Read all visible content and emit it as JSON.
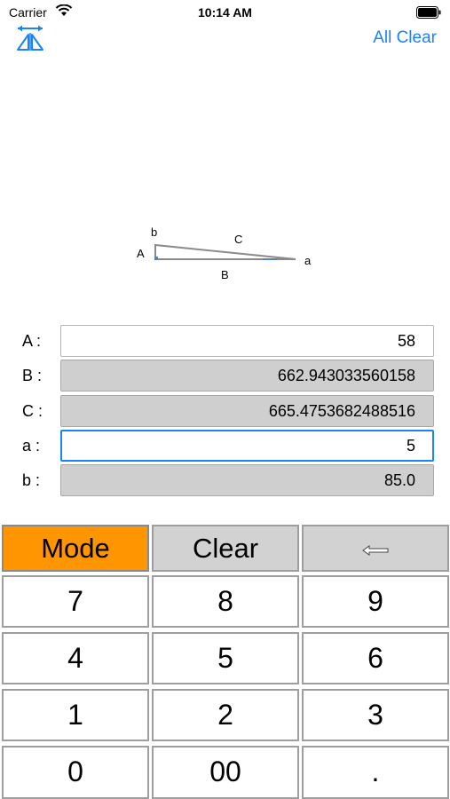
{
  "status_bar": {
    "carrier": "Carrier",
    "time": "10:14 AM"
  },
  "nav": {
    "mirror_icon": "mirror-flip-icon",
    "all_clear_label": "All Clear"
  },
  "diagram": {
    "vertex_labels": {
      "b": "b",
      "A": "A",
      "C": "C",
      "B": "B",
      "a": "a"
    }
  },
  "fields": [
    {
      "label": "A :",
      "value": "58"
    },
    {
      "label": "B :",
      "value": "662.943033560158"
    },
    {
      "label": "C :",
      "value": "665.4753682488516"
    },
    {
      "label": "a :",
      "value": "5"
    },
    {
      "label": "b :",
      "value": "85.0"
    }
  ],
  "keypad": {
    "mode": "Mode",
    "clear": "Clear",
    "backspace_icon": "backspace-arrow-icon",
    "digits": [
      "7",
      "8",
      "9",
      "4",
      "5",
      "6",
      "1",
      "2",
      "3",
      "0",
      "00",
      "."
    ]
  },
  "colors": {
    "accent": "#1a82fb",
    "mode_key": "#ff9500",
    "readonly_field": "#cfcfcf"
  }
}
